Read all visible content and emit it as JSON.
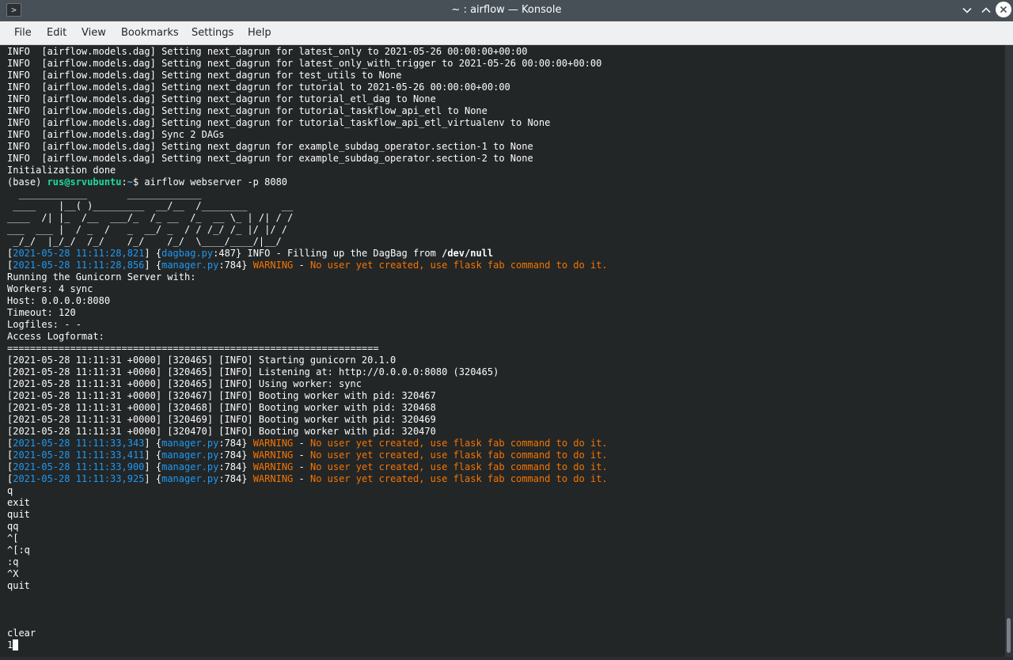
{
  "window": {
    "app_icon_glyph": ">",
    "title": "~ : airflow — Konsole",
    "controls": [
      "chevron-down-icon",
      "chevron-up-icon",
      "close-icon"
    ]
  },
  "menu": {
    "items": [
      "File",
      "Edit",
      "View",
      "Bookmarks",
      "Settings",
      "Help"
    ]
  },
  "colors": {
    "titlebar": "#475057",
    "menubar": "#eff0f1",
    "terminal_bg": "#232627",
    "text": "#fcfcfc",
    "log_blue": "#1d99f3",
    "warning_orange": "#f67400",
    "prompt_green": "#1cdc9a",
    "path_cyan": "#3daee9"
  },
  "terminal": {
    "lines": [
      [
        {
          "t": "INFO  [airflow.models.dag] Setting next_dagrun for latest_only to 2021-05-26 00:00:00+00:00"
        }
      ],
      [
        {
          "t": "INFO  [airflow.models.dag] Setting next_dagrun for latest_only_with_trigger to 2021-05-26 00:00:00+00:00"
        }
      ],
      [
        {
          "t": "INFO  [airflow.models.dag] Setting next_dagrun for test_utils to None"
        }
      ],
      [
        {
          "t": "INFO  [airflow.models.dag] Setting next_dagrun for tutorial to 2021-05-26 00:00:00+00:00"
        }
      ],
      [
        {
          "t": "INFO  [airflow.models.dag] Setting next_dagrun for tutorial_etl_dag to None"
        }
      ],
      [
        {
          "t": "INFO  [airflow.models.dag] Setting next_dagrun for tutorial_taskflow_api_etl to None"
        }
      ],
      [
        {
          "t": "INFO  [airflow.models.dag] Setting next_dagrun for tutorial_taskflow_api_etl_virtualenv to None"
        }
      ],
      [
        {
          "t": "INFO  [airflow.models.dag] Sync 2 DAGs"
        }
      ],
      [
        {
          "t": "INFO  [airflow.models.dag] Setting next_dagrun for example_subdag_operator.section-1 to None"
        }
      ],
      [
        {
          "t": "INFO  [airflow.models.dag] Setting next_dagrun for example_subdag_operator.section-2 to None"
        }
      ],
      [
        {
          "t": "Initialization done"
        }
      ],
      [
        {
          "t": "(base) "
        },
        {
          "t": "rus@srvubuntu",
          "c": "green"
        },
        {
          "t": ":"
        },
        {
          "t": "~",
          "c": "cyan"
        },
        {
          "t": "$ airflow webserver -p 8080"
        }
      ],
      [
        {
          "t": "  ____________       _____________"
        }
      ],
      [
        {
          "t": " ____    |__( )_________  __/__  /________      __"
        }
      ],
      [
        {
          "t": "____  /| |_  /__  ___/_  /_ __  /_  __ \\_ | /| / /"
        }
      ],
      [
        {
          "t": "___  ___ |  / _  /   _  __/ _  / / /_/ /_ |/ |/ /"
        }
      ],
      [
        {
          "t": " _/_/  |_/_/  /_/    /_/    /_/  \\____/____/|__/"
        }
      ],
      [
        {
          "t": "["
        },
        {
          "t": "2021-05-28 11:11:28,821",
          "c": "blue"
        },
        {
          "t": "] {"
        },
        {
          "t": "dagbag.py",
          "c": "blue"
        },
        {
          "t": ":487} INFO - Filling up the DagBag from "
        },
        {
          "t": "/dev/null",
          "c": "bold"
        }
      ],
      [
        {
          "t": "["
        },
        {
          "t": "2021-05-28 11:11:28,856",
          "c": "blue"
        },
        {
          "t": "] {"
        },
        {
          "t": "manager.py",
          "c": "blue"
        },
        {
          "t": ":784} "
        },
        {
          "t": "WARNING",
          "c": "orange"
        },
        {
          "t": " - "
        },
        {
          "t": "No user yet created, use flask fab command to do it.",
          "c": "orange"
        }
      ],
      [
        {
          "t": "Running the Gunicorn Server with:"
        }
      ],
      [
        {
          "t": "Workers: 4 sync"
        }
      ],
      [
        {
          "t": "Host: 0.0.0.0:8080"
        }
      ],
      [
        {
          "t": "Timeout: 120"
        }
      ],
      [
        {
          "t": "Logfiles: - -"
        }
      ],
      [
        {
          "t": "Access Logformat:"
        }
      ],
      [
        {
          "t": "================================================================="
        }
      ],
      [
        {
          "t": "[2021-05-28 11:11:31 +0000] [320465] [INFO] Starting gunicorn 20.1.0"
        }
      ],
      [
        {
          "t": "[2021-05-28 11:11:31 +0000] [320465] [INFO] Listening at: http://0.0.0.0:8080 (320465)"
        }
      ],
      [
        {
          "t": "[2021-05-28 11:11:31 +0000] [320465] [INFO] Using worker: sync"
        }
      ],
      [
        {
          "t": "[2021-05-28 11:11:31 +0000] [320467] [INFO] Booting worker with pid: 320467"
        }
      ],
      [
        {
          "t": "[2021-05-28 11:11:31 +0000] [320468] [INFO] Booting worker with pid: 320468"
        }
      ],
      [
        {
          "t": "[2021-05-28 11:11:31 +0000] [320469] [INFO] Booting worker with pid: 320469"
        }
      ],
      [
        {
          "t": "[2021-05-28 11:11:31 +0000] [320470] [INFO] Booting worker with pid: 320470"
        }
      ],
      [
        {
          "t": "["
        },
        {
          "t": "2021-05-28 11:11:33,343",
          "c": "blue"
        },
        {
          "t": "] {"
        },
        {
          "t": "manager.py",
          "c": "blue"
        },
        {
          "t": ":784} "
        },
        {
          "t": "WARNING",
          "c": "orange"
        },
        {
          "t": " - "
        },
        {
          "t": "No user yet created, use flask fab command to do it.",
          "c": "orange"
        }
      ],
      [
        {
          "t": "["
        },
        {
          "t": "2021-05-28 11:11:33,411",
          "c": "blue"
        },
        {
          "t": "] {"
        },
        {
          "t": "manager.py",
          "c": "blue"
        },
        {
          "t": ":784} "
        },
        {
          "t": "WARNING",
          "c": "orange"
        },
        {
          "t": " - "
        },
        {
          "t": "No user yet created, use flask fab command to do it.",
          "c": "orange"
        }
      ],
      [
        {
          "t": "["
        },
        {
          "t": "2021-05-28 11:11:33,900",
          "c": "blue"
        },
        {
          "t": "] {"
        },
        {
          "t": "manager.py",
          "c": "blue"
        },
        {
          "t": ":784} "
        },
        {
          "t": "WARNING",
          "c": "orange"
        },
        {
          "t": " - "
        },
        {
          "t": "No user yet created, use flask fab command to do it.",
          "c": "orange"
        }
      ],
      [
        {
          "t": "["
        },
        {
          "t": "2021-05-28 11:11:33,925",
          "c": "blue"
        },
        {
          "t": "] {"
        },
        {
          "t": "manager.py",
          "c": "blue"
        },
        {
          "t": ":784} "
        },
        {
          "t": "WARNING",
          "c": "orange"
        },
        {
          "t": " - "
        },
        {
          "t": "No user yet created, use flask fab command to do it.",
          "c": "orange"
        }
      ],
      [
        {
          "t": "q"
        }
      ],
      [
        {
          "t": "exit"
        }
      ],
      [
        {
          "t": "quit"
        }
      ],
      [
        {
          "t": "qq"
        }
      ],
      [
        {
          "t": "^["
        }
      ],
      [
        {
          "t": "^[:q"
        }
      ],
      [
        {
          "t": ":q"
        }
      ],
      [
        {
          "t": "^X"
        }
      ],
      [
        {
          "t": "quit"
        }
      ],
      [],
      [],
      [],
      [
        {
          "t": "clear"
        }
      ],
      [
        {
          "t": "1"
        }
      ]
    ]
  }
}
